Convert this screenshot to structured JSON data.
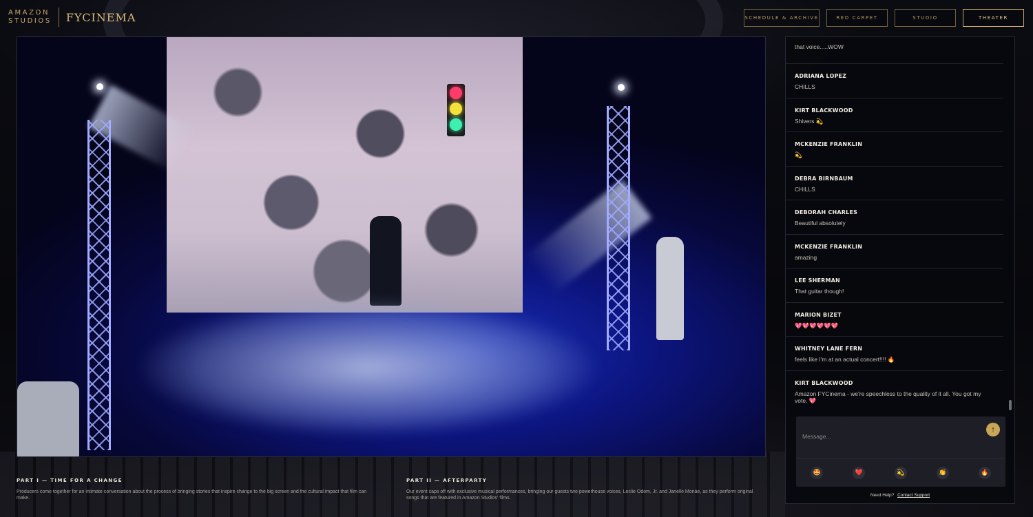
{
  "brand": {
    "amazon_line1": "AMAZON",
    "amazon_line2": "STUDIOS",
    "fycinema": "FYCINEMA"
  },
  "nav": [
    {
      "label": "SCHEDULE & ARCHIVE",
      "active": false
    },
    {
      "label": "RED CARPET",
      "active": false
    },
    {
      "label": "STUDIO",
      "active": false
    },
    {
      "label": "THEATER",
      "active": true
    }
  ],
  "captions": [
    {
      "title": "PART I — TIME FOR A CHANGE",
      "body": "Producers come together for an intimate conversation about the process of bringing stories that inspire change to the big screen and the cultural impact that film can make."
    },
    {
      "title": "PART II — AFTERPARTY",
      "body": "Our event caps off with exclusive musical performances, bringing our guests two powerhouse voices, Leslie Odom, Jr. and Janelle Monáe, as they perform original songs that are featured in Amazon Studios' films."
    }
  ],
  "chat": {
    "messages": [
      {
        "name": "",
        "text": "that voice.....WOW"
      },
      {
        "name": "ADRIANA LOPEZ",
        "text": "CHILLS"
      },
      {
        "name": "KIRT BLACKWOOD",
        "text": "Shivers 💫"
      },
      {
        "name": "MCKENZIE FRANKLIN",
        "text": "💫"
      },
      {
        "name": "DEBRA BIRNBAUM",
        "text": "CHILLS"
      },
      {
        "name": "DEBORAH CHARLES",
        "text": "Beautiful absolutely"
      },
      {
        "name": "MCKENZIE FRANKLIN",
        "text": "amazing"
      },
      {
        "name": "LEE SHERMAN",
        "text": "That guitar though!"
      },
      {
        "name": "MARION BIZET",
        "text": "💖💖💖💖💖💖"
      },
      {
        "name": "WHITNEY LANE FERN",
        "text": "feels like I'm at an actual concert!!!! 🔥"
      },
      {
        "name": "KIRT BLACKWOOD",
        "text": "Amazon FYCinema - we're speechless to the quality of it all. You got my vote. 💖"
      }
    ],
    "input_placeholder": "Message...",
    "send_icon": "arrow-up-icon",
    "reactions": [
      {
        "name": "star-struck-icon",
        "glyph": "🤩"
      },
      {
        "name": "heart-icon",
        "glyph": "❤️"
      },
      {
        "name": "dizzy-icon",
        "glyph": "💫"
      },
      {
        "name": "clap-icon",
        "glyph": "👏"
      },
      {
        "name": "fire-icon",
        "glyph": "🔥"
      }
    ],
    "help_text": "Need Help?",
    "help_link": "Contact Support"
  },
  "colors": {
    "gold": "#c9a96b",
    "panel_bg": "#08090d",
    "accent_send": "#c9a558"
  }
}
